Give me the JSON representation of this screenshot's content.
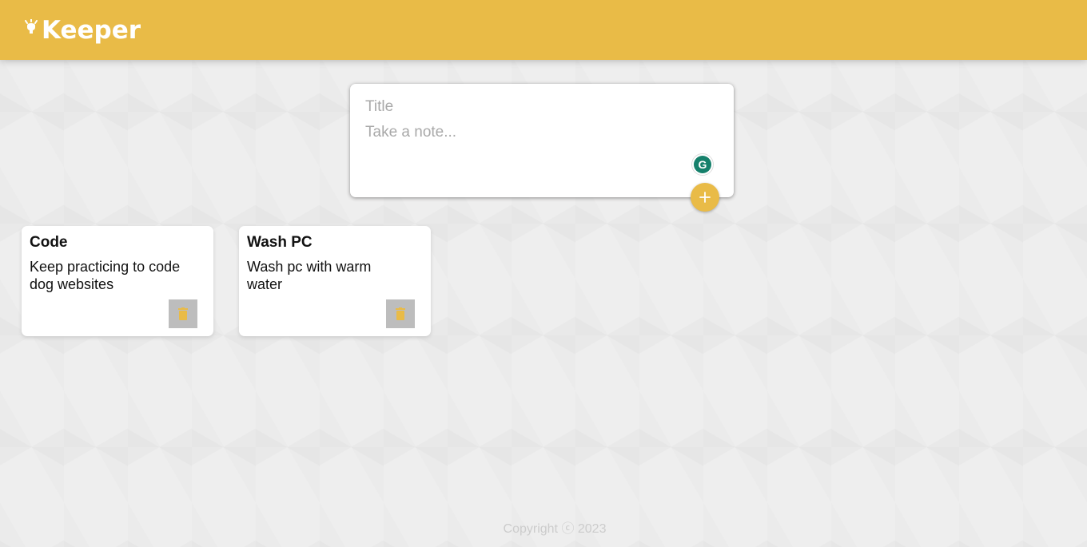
{
  "header": {
    "logo_text": "Keeper",
    "logo_icon": "lightbulb-icon",
    "background_color": "#e9bb47"
  },
  "create_note": {
    "title_placeholder": "Title",
    "content_placeholder": "Take a note...",
    "title_value": "",
    "content_value": "",
    "add_icon": "plus-icon",
    "grammarly_icon": "grammarly-icon"
  },
  "notes": [
    {
      "title": "Code",
      "content": "Keep practicing to code dog websites",
      "delete_icon": "trash-icon"
    },
    {
      "title": "Wash PC",
      "content": "Wash pc with warm water",
      "delete_icon": "trash-icon"
    }
  ],
  "footer": {
    "copyright": "Copyright ⓒ 2023"
  },
  "colors": {
    "accent": "#e9bb47",
    "delete_button": "#bdbdbd",
    "grammarly": "#15806b"
  }
}
